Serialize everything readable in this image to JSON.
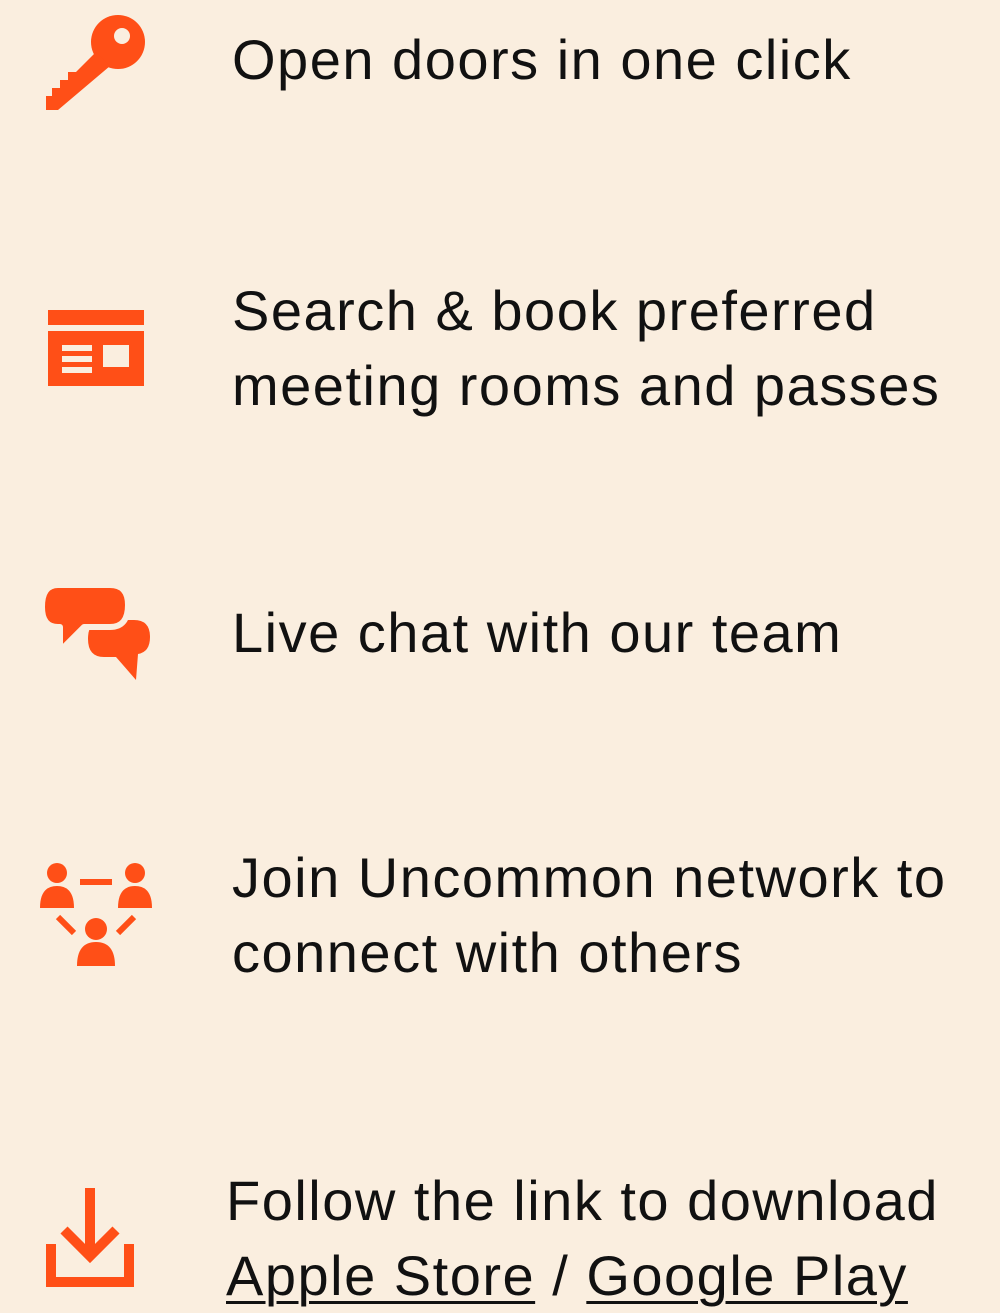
{
  "accent_color": "#FF4F17",
  "background_color": "#FAEEDF",
  "features": [
    {
      "icon": "key-icon",
      "lines": [
        "Open doors in one click"
      ]
    },
    {
      "icon": "booking-card-icon",
      "lines": [
        "Search & book preferred",
        "meeting rooms and passes"
      ]
    },
    {
      "icon": "chat-bubbles-icon",
      "lines": [
        "Live chat with our team"
      ]
    },
    {
      "icon": "network-people-icon",
      "lines": [
        "Join Uncommon network to",
        "connect with others"
      ]
    },
    {
      "icon": "download-icon",
      "lines": [
        "Follow the link to download"
      ]
    }
  ],
  "download": {
    "apple_label": "Apple Store",
    "separator": " / ",
    "google_label": "Google Play"
  }
}
